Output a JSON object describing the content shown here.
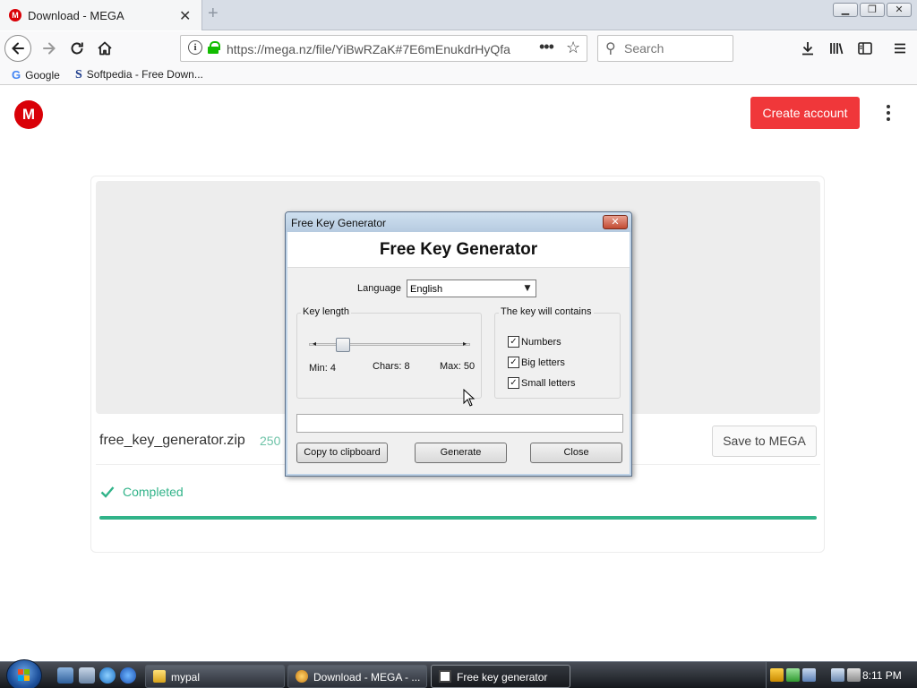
{
  "browser": {
    "tab": {
      "title": "Download - MEGA",
      "favicon_letter": "M",
      "close": "✕"
    },
    "new_tab": "+",
    "window_controls": [
      "▁",
      "❐",
      "✕"
    ],
    "nav": {
      "back_icon": "arrow-left-icon",
      "forward_icon": "arrow-right-icon",
      "reload_icon": "reload-icon",
      "home_icon": "home-icon"
    },
    "url": "https://mega.nz/file/YiBwRZaK#7E6mEnukdrHyQfa",
    "url_menu": "•••",
    "bookmark_star": "☆",
    "search_placeholder": "Search",
    "toolbar_icons": [
      "download-icon",
      "library-icon",
      "sidebar-icon",
      "hamburger-menu-icon"
    ],
    "bookmarks": [
      {
        "icon": "G",
        "label": "Google"
      },
      {
        "icon": "S",
        "label": "Softpedia - Free Down..."
      }
    ]
  },
  "page": {
    "logo_letter": "M",
    "create_account": "Create account",
    "file_name": "free_key_generator.zip",
    "file_size": "250",
    "save_to_mega": "Save to MEGA",
    "status": "Completed",
    "progress": 1.0,
    "accent_color": "#31b389",
    "brand_color": "#d90007",
    "button_color": "#f0373a"
  },
  "dialog": {
    "window_title": "Free Key Generator",
    "heading": "Free Key Generator",
    "language_label": "Language",
    "language_value": "English",
    "key_length_group": "Key length",
    "slider_min": "Min: 4",
    "slider_chars": "Chars: 8",
    "slider_max": "Max: 50",
    "contains_group": "The key will contains",
    "options": [
      {
        "label": "Numbers",
        "checked": true
      },
      {
        "label": "Big letters",
        "checked": true
      },
      {
        "label": "Small letters",
        "checked": true
      }
    ],
    "key_output": "",
    "buttons": {
      "copy": "Copy to clipboard",
      "generate": "Generate",
      "close": "Close"
    }
  },
  "taskbar": {
    "tasks": [
      {
        "label": "mypal"
      },
      {
        "label": "Download - MEGA - ..."
      },
      {
        "label": "Free key generator"
      }
    ],
    "clock": "8:11 PM"
  }
}
